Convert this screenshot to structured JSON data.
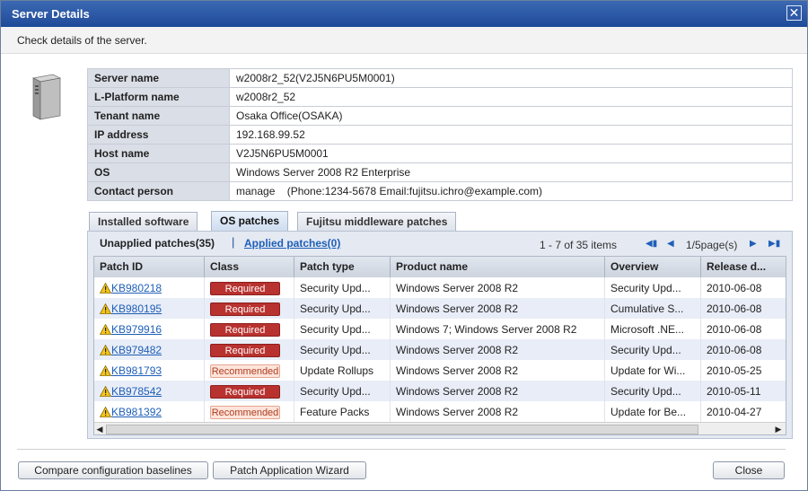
{
  "window": {
    "title": "Server Details",
    "close_glyph": "✕"
  },
  "description": "Check details of the server.",
  "server_icon": "server-tower-icon",
  "info": [
    {
      "label": "Server name",
      "value": "w2008r2_52(V2J5N6PU5M0001)"
    },
    {
      "label": "L-Platform name",
      "value": "w2008r2_52"
    },
    {
      "label": "Tenant name",
      "value": "Osaka Office(OSAKA)"
    },
    {
      "label": "IP address",
      "value": "192.168.99.52"
    },
    {
      "label": "Host name",
      "value": "V2J5N6PU5M0001"
    },
    {
      "label": "OS",
      "value": "Windows Server 2008 R2 Enterprise"
    },
    {
      "label": "Contact person",
      "value": "manage    (Phone:1234-5678 Email:fujitsu.ichro@example.com)"
    }
  ],
  "tabs": [
    {
      "label": "Installed software",
      "active": false
    },
    {
      "label": "OS patches",
      "active": true
    },
    {
      "label": "Fujitsu middleware patches",
      "active": false
    }
  ],
  "subtabs": {
    "unapplied": "Unapplied patches(35)",
    "separator": "|",
    "applied": "Applied patches(0)"
  },
  "pager": {
    "info": "1 - 7 of 35 items",
    "page": "1/5page(s)",
    "first": "first-page-icon",
    "prev": "prev-page-icon",
    "next": "next-page-icon",
    "last": "last-page-icon"
  },
  "grid": {
    "columns": [
      "Patch ID",
      "Class",
      "Patch type",
      "Product name",
      "Overview",
      "Release d..."
    ],
    "rows": [
      {
        "id": "KB980218",
        "class": "Required",
        "type": "Security Upd...",
        "product": "Windows Server 2008 R2",
        "overview": "Security Upd...",
        "release": "2010-06-08"
      },
      {
        "id": "KB980195",
        "class": "Required",
        "type": "Security Upd...",
        "product": "Windows Server 2008 R2",
        "overview": "Cumulative S...",
        "release": "2010-06-08"
      },
      {
        "id": "KB979916",
        "class": "Required",
        "type": "Security Upd...",
        "product": "Windows 7; Windows Server 2008 R2",
        "overview": "Microsoft .NE...",
        "release": "2010-06-08"
      },
      {
        "id": "KB979482",
        "class": "Required",
        "type": "Security Upd...",
        "product": "Windows Server 2008 R2",
        "overview": "Security Upd...",
        "release": "2010-06-08"
      },
      {
        "id": "KB981793",
        "class": "Recommended",
        "type": "Update Rollups",
        "product": "Windows Server 2008 R2",
        "overview": "Update for Wi...",
        "release": "2010-05-25"
      },
      {
        "id": "KB978542",
        "class": "Required",
        "type": "Security Upd...",
        "product": "Windows Server 2008 R2",
        "overview": "Security Upd...",
        "release": "2010-05-11"
      },
      {
        "id": "KB981392",
        "class": "Recommended",
        "type": "Feature Packs",
        "product": "Windows Server 2008 R2",
        "overview": "Update for Be...",
        "release": "2010-04-27"
      }
    ]
  },
  "buttons": {
    "compare": "Compare configuration baselines",
    "wizard": "Patch Application Wizard",
    "close": "Close"
  },
  "colors": {
    "title_bar": "#2a58a8",
    "required": "#b8322f",
    "recommended_bg": "#fde4da",
    "link": "#1f5fb8"
  }
}
